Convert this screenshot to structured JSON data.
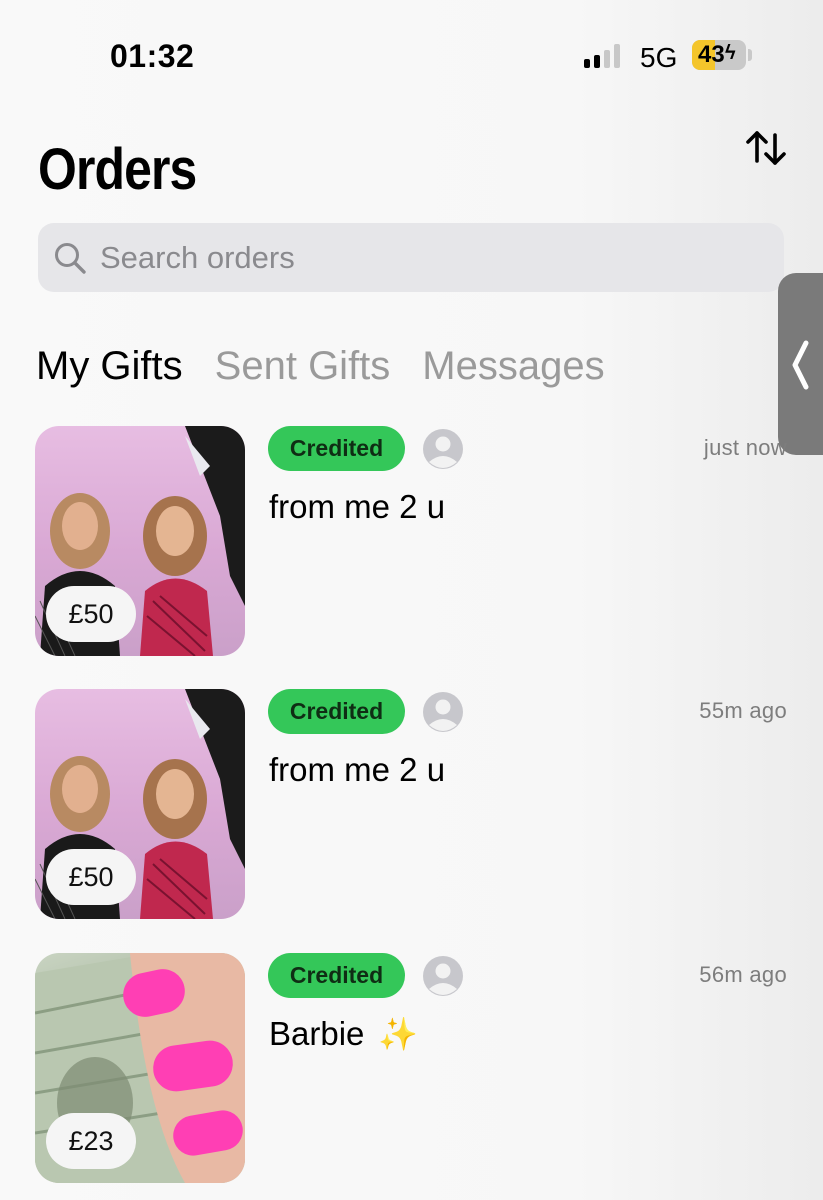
{
  "status_bar": {
    "time": "01:32",
    "network": "5G",
    "battery": "43",
    "battery_level": 0.43
  },
  "header": {
    "title": "Orders",
    "sort_icon": "sort-arrows-icon"
  },
  "search": {
    "placeholder": "Search orders"
  },
  "tabs": [
    {
      "label": "My Gifts",
      "active": true
    },
    {
      "label": "Sent Gifts",
      "active": false
    },
    {
      "label": "Messages",
      "active": false
    }
  ],
  "orders": [
    {
      "price": "£50",
      "status": "Credited",
      "note": "from me 2 u",
      "time": "just now",
      "emoji": ""
    },
    {
      "price": "£50",
      "status": "Credited",
      "note": "from me 2 u",
      "time": "55m ago",
      "emoji": ""
    },
    {
      "price": "£23",
      "status": "Credited",
      "note": "Barbie",
      "time": "56m ago",
      "emoji": "✨"
    }
  ],
  "colors": {
    "credited_badge": "#34c759",
    "battery_fill": "#f4c52b",
    "accent_pink": "#ff3fb4"
  }
}
